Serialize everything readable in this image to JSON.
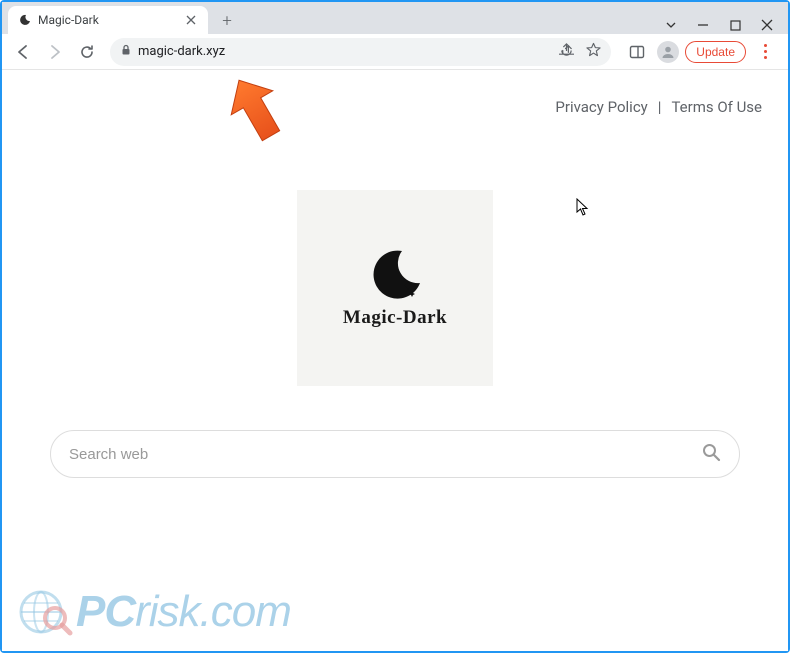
{
  "browser": {
    "tab": {
      "title": "Magic-Dark"
    },
    "url": "magic-dark.xyz",
    "update_label": "Update"
  },
  "page": {
    "nav": {
      "privacy": "Privacy Policy",
      "terms": "Terms Of Use"
    },
    "logo_text": "Magic-Dark",
    "search": {
      "placeholder": "Search web"
    }
  },
  "watermark": {
    "text_left": "PC",
    "text_right": "risk.com"
  }
}
